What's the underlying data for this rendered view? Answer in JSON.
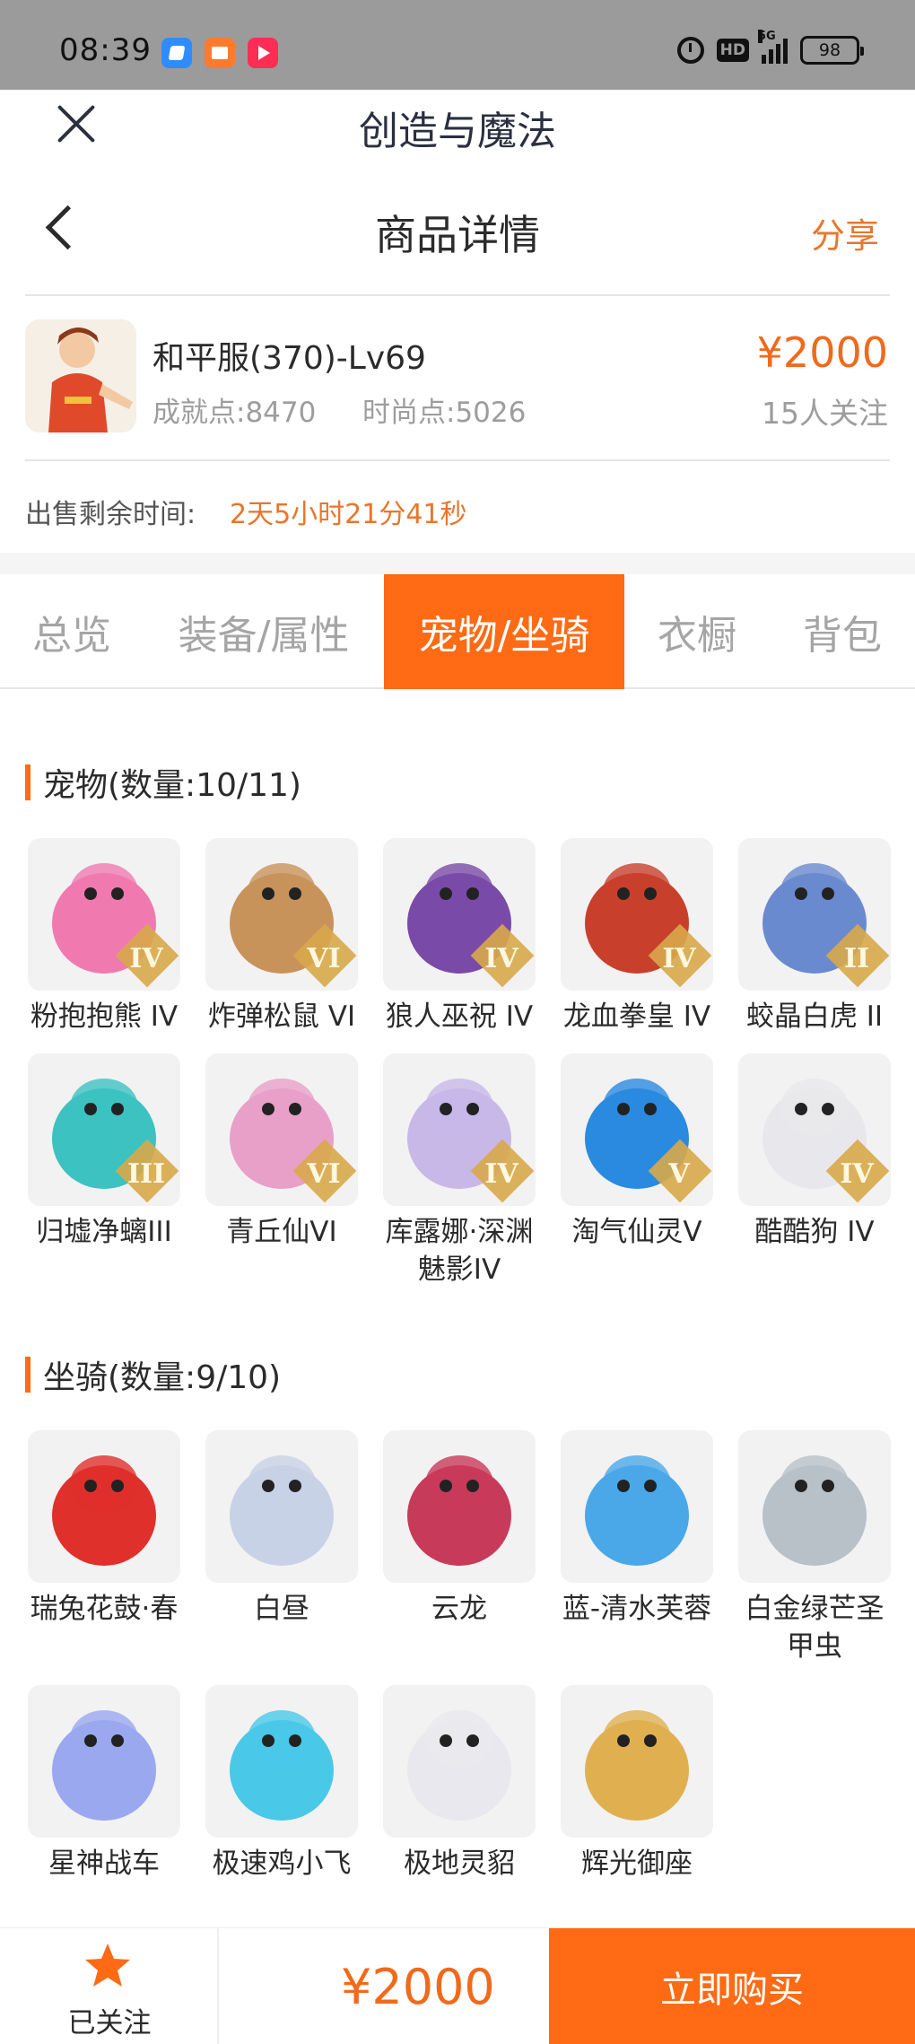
{
  "status": {
    "time": "08:39",
    "hd": "HD",
    "network": "5G",
    "battery": "98"
  },
  "header": {
    "app_title": "创造与魔法",
    "page_title": "商品详情",
    "share": "分享"
  },
  "product": {
    "name": "和平服(370)-Lv69",
    "achievement": "成就点:8470",
    "fashion": "时尚点:5026",
    "price": "¥2000",
    "followers": "15人关注",
    "remain_label": "出售剩余时间:",
    "remain_value": "2天5小时21分41秒"
  },
  "tabs": [
    "总览",
    "装备/属性",
    "宠物/坐骑",
    "衣橱",
    "背包"
  ],
  "active_tab": 2,
  "pets": {
    "title": "宠物",
    "count": "(数量:10/11)",
    "items": [
      {
        "name": "粉抱抱熊 IV",
        "rank": "IV",
        "color": "#f07ab0"
      },
      {
        "name": "炸弹松鼠 VI",
        "rank": "VI",
        "color": "#c8935a"
      },
      {
        "name": "狼人巫祝 IV",
        "rank": "IV",
        "color": "#7a4aa8"
      },
      {
        "name": "龙血拳皇 IV",
        "rank": "IV",
        "color": "#c8402c"
      },
      {
        "name": "蛟晶白虎 II",
        "rank": "II",
        "color": "#6a8ad0"
      },
      {
        "name": "归墟净螭III",
        "rank": "III",
        "color": "#3cc2c0"
      },
      {
        "name": "青丘仙VI",
        "rank": "VI",
        "color": "#e8a0c8"
      },
      {
        "name": "库露娜·深渊魅影IV",
        "rank": "IV",
        "color": "#c8b8e8"
      },
      {
        "name": "淘气仙灵V",
        "rank": "V",
        "color": "#2a8ae0"
      },
      {
        "name": "酷酷狗 IV",
        "rank": "IV",
        "color": "#e8e8ec"
      }
    ]
  },
  "mounts": {
    "title": "坐骑",
    "count": "(数量:9/10)",
    "items": [
      {
        "name": "瑞兔花鼓·春",
        "color": "#e0302c"
      },
      {
        "name": "白昼",
        "color": "#c8d2e6"
      },
      {
        "name": "云龙",
        "color": "#c83a5a"
      },
      {
        "name": "蓝-清水芙蓉",
        "color": "#4aa8e8"
      },
      {
        "name": "白金绿芒圣甲虫",
        "color": "#b8c0c8"
      },
      {
        "name": "星神战车",
        "color": "#9aa8f0"
      },
      {
        "name": "极速鸡小飞",
        "color": "#4ac8e8"
      },
      {
        "name": "极地灵貂",
        "color": "#e8e8ee"
      },
      {
        "name": "辉光御座",
        "color": "#e0b050"
      }
    ]
  },
  "bottom": {
    "follow_label": "已关注",
    "price": "¥2000",
    "buy_label": "立即购买"
  },
  "colors": {
    "accent": "#ff6a14",
    "price": "#f06a1c"
  }
}
